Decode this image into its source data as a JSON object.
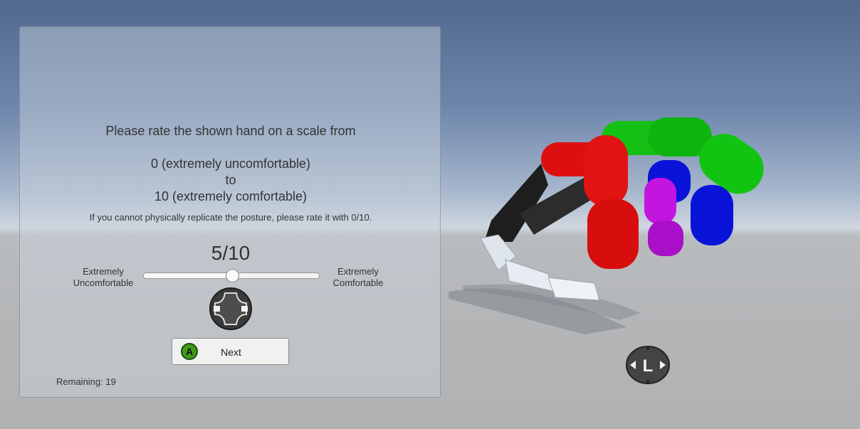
{
  "prompt": {
    "line1": "Please rate the shown hand on a scale from",
    "line2": "0  (extremely uncomfortable)",
    "line3": "to",
    "line4": "10 (extremely comfortable)",
    "note": "If you cannot physically replicate the posture, please rate it with 0/10."
  },
  "rating": {
    "display": "5/10",
    "value": 5,
    "min": 0,
    "max": 10,
    "left_label": "Extremely Uncomfortable",
    "right_label": "Extremely Comfortable"
  },
  "next_button": {
    "badge": "A",
    "label": "Next"
  },
  "remaining": "Remaining: 19",
  "stick_hint": {
    "letter": "L"
  },
  "colors": {
    "thumb": "#2a2a2a",
    "index": "#dd0f0f",
    "middle": "#10c010",
    "ring": "#0a14d8",
    "pinky": "#b10fd0",
    "fingertip": "#e6ecf2",
    "button_badge": "#3f9a19"
  }
}
